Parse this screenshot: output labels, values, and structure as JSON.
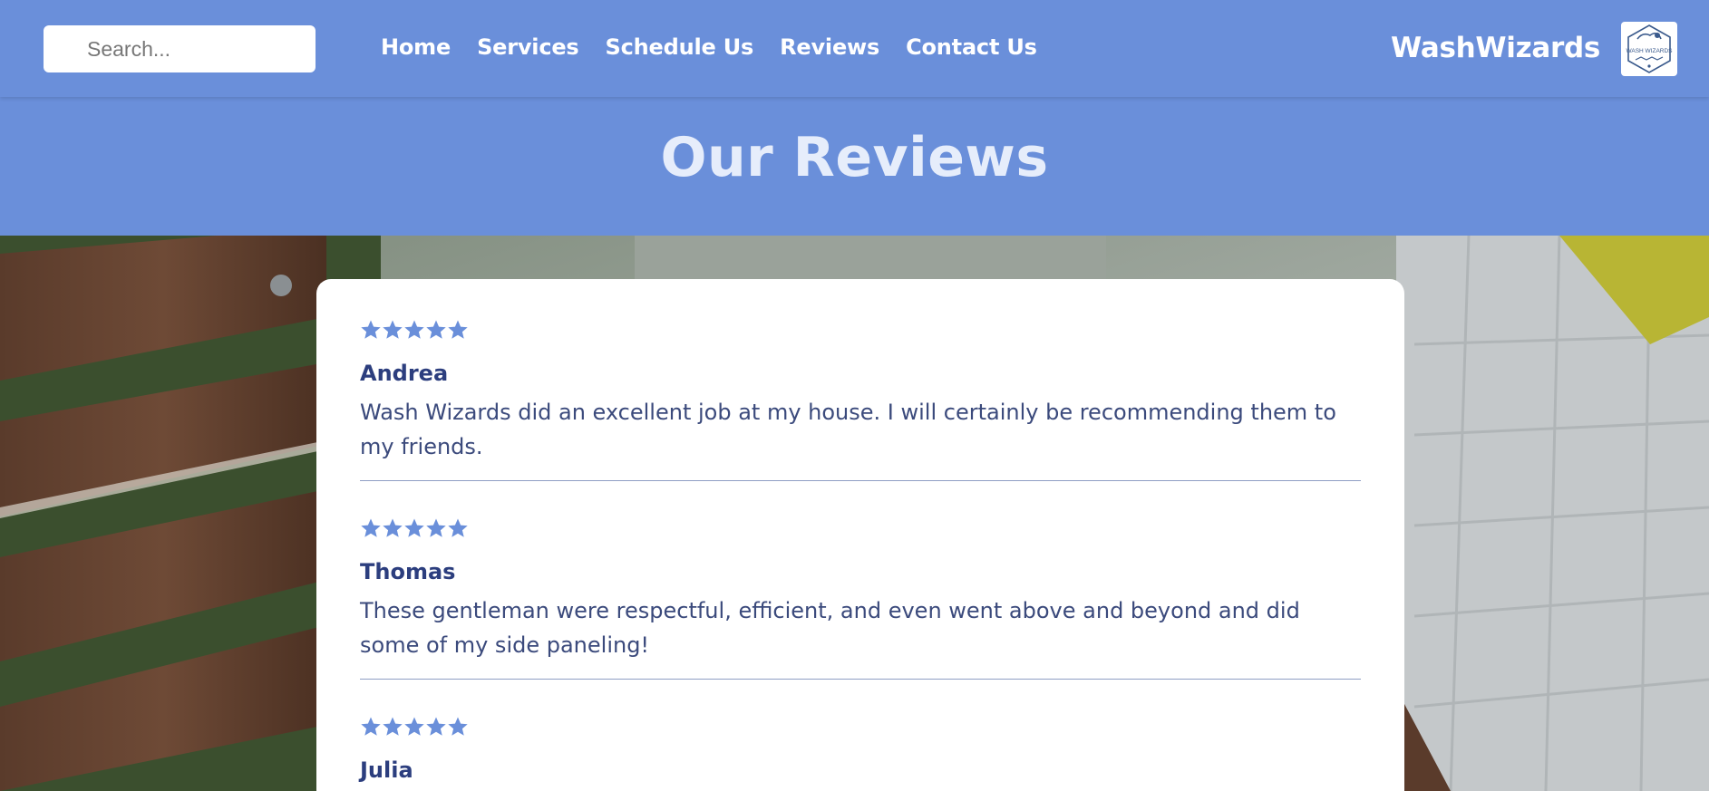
{
  "header": {
    "search": {
      "placeholder": "Search...",
      "value": ""
    },
    "nav": [
      {
        "label": "Home"
      },
      {
        "label": "Services"
      },
      {
        "label": "Schedule Us"
      },
      {
        "label": "Reviews"
      },
      {
        "label": "Contact Us"
      }
    ],
    "brand": "WashWizards",
    "logo_text": "WASH WIZARDS"
  },
  "hero": {
    "title": "Our Reviews"
  },
  "reviews": [
    {
      "rating": 5,
      "name": "Andrea",
      "text": "Wash Wizards did an excellent job at my house. I will certainly be recommending them to my friends."
    },
    {
      "rating": 5,
      "name": "Thomas",
      "text": "These gentleman were respectful, efficient, and even went above and beyond and did some of my side paneling!"
    },
    {
      "rating": 5,
      "name": "Julia",
      "text": ""
    }
  ],
  "colors": {
    "header_bg": "#6a8fda",
    "star": "#6a8fda",
    "reviewer_name": "#2c3e7e",
    "review_text": "#3b4a7c"
  },
  "icons": {
    "star": "star-icon",
    "logo": "wash-wizards-logo"
  }
}
